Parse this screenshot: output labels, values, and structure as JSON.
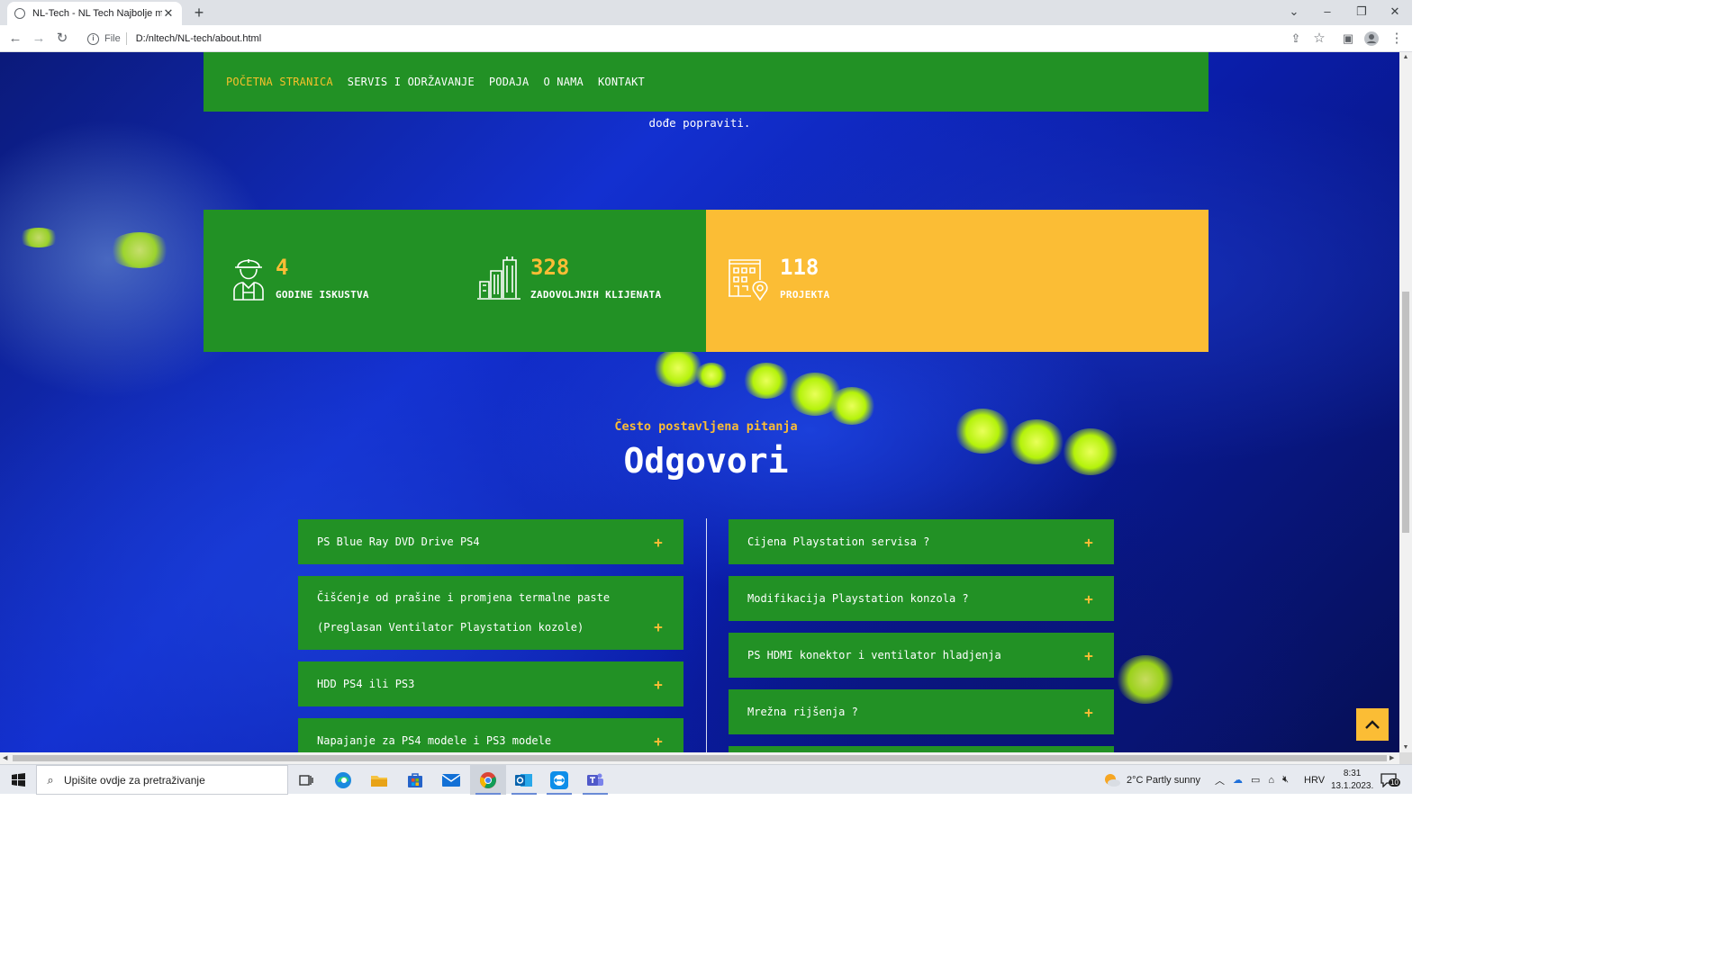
{
  "browser": {
    "tab_title": "NL-Tech - NL Tech Najbolje mjes",
    "url_scheme": "File",
    "url": "D:/nltech/NL-tech/about.html"
  },
  "nav": {
    "items": [
      "POČETNA STRANICA",
      "SERVIS I ODRŽAVANJE",
      "PODAJA",
      "O NAMA",
      "KONTAKT"
    ]
  },
  "intro_tail": "dođe popraviti.",
  "stats": [
    {
      "value": "4",
      "label": "GODINE ISKUSTVA",
      "icon": "worker-icon"
    },
    {
      "value": "328",
      "label": "ZADOVOLJNIH KLIJENATA",
      "icon": "buildings-icon"
    },
    {
      "value": "118",
      "label": "PROJEKTA",
      "icon": "building-location-icon"
    }
  ],
  "faq": {
    "kicker": "Često postavljena pitanja",
    "title": "Odgovori",
    "left": [
      "PS Blue Ray DVD Drive PS4",
      "Čišćenje od prašine i promjena termalne paste (Preglasan Ventilator Playstation kozole)",
      "HDD PS4 ili PS3",
      "Napajanje za PS4 modele i PS3 modele"
    ],
    "right": [
      "Cijena Playstation servisa ?",
      "Modifikacija Playstation konzola ?",
      "PS HDMI konektor i ventilator hladjenja",
      "Mrežna rijšenja ?"
    ]
  },
  "taskbar": {
    "search_placeholder": "Upišite ovdje za pretraživanje",
    "weather": "2°C  Partly sunny",
    "language": "HRV",
    "time": "8:31",
    "date": "13.1.2023.",
    "notifications": "10"
  },
  "colors": {
    "green": "#229125",
    "yellow": "#fbbd35"
  }
}
